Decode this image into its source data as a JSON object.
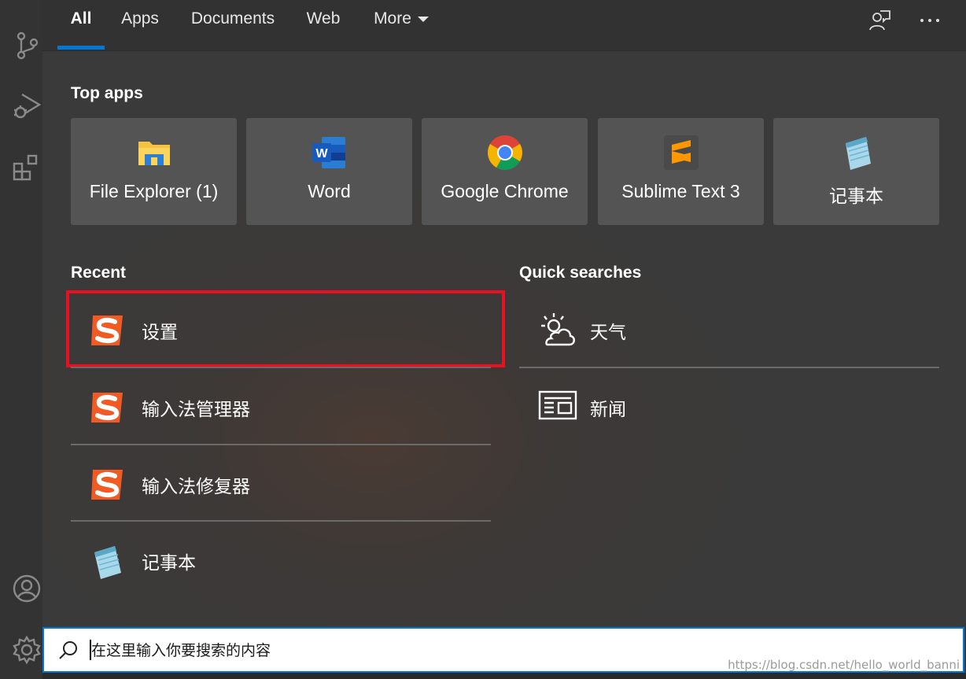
{
  "tabs": [
    {
      "label": "All",
      "active": true
    },
    {
      "label": "Apps"
    },
    {
      "label": "Documents"
    },
    {
      "label": "Web"
    },
    {
      "label": "More"
    }
  ],
  "toolbar": {
    "feedback_icon": "feedback-icon",
    "more_icon": "ellipsis-icon"
  },
  "activity_bar": {
    "icons": [
      "source-control-icon",
      "run-debug-icon",
      "extensions-icon",
      "account-icon",
      "settings-gear-icon"
    ]
  },
  "top_apps": {
    "title": "Top apps",
    "items": [
      {
        "label": "File Explorer (1)",
        "icon": "file-explorer-icon"
      },
      {
        "label": "Word",
        "icon": "word-icon"
      },
      {
        "label": "Google Chrome",
        "icon": "chrome-icon"
      },
      {
        "label": "Sublime Text 3",
        "icon": "sublime-text-icon"
      },
      {
        "label": "记事本",
        "icon": "notepad-icon"
      }
    ]
  },
  "recent": {
    "title": "Recent",
    "items": [
      {
        "label": "设置",
        "icon": "sogou-icon",
        "highlighted": true
      },
      {
        "label": "输入法管理器",
        "icon": "sogou-icon"
      },
      {
        "label": "输入法修复器",
        "icon": "sogou-icon"
      },
      {
        "label": "记事本",
        "icon": "notepad-icon"
      }
    ]
  },
  "quick_searches": {
    "title": "Quick searches",
    "items": [
      {
        "label": "天气",
        "icon": "weather-icon"
      },
      {
        "label": "新闻",
        "icon": "news-icon"
      }
    ]
  },
  "search": {
    "placeholder": "在这里输入你要搜索的内容",
    "value": ""
  },
  "watermark": "https://blog.csdn.net/hello_world_banni",
  "colors": {
    "accent": "#0078d7",
    "highlight": "#e81123",
    "sogou": "#f15a22"
  }
}
